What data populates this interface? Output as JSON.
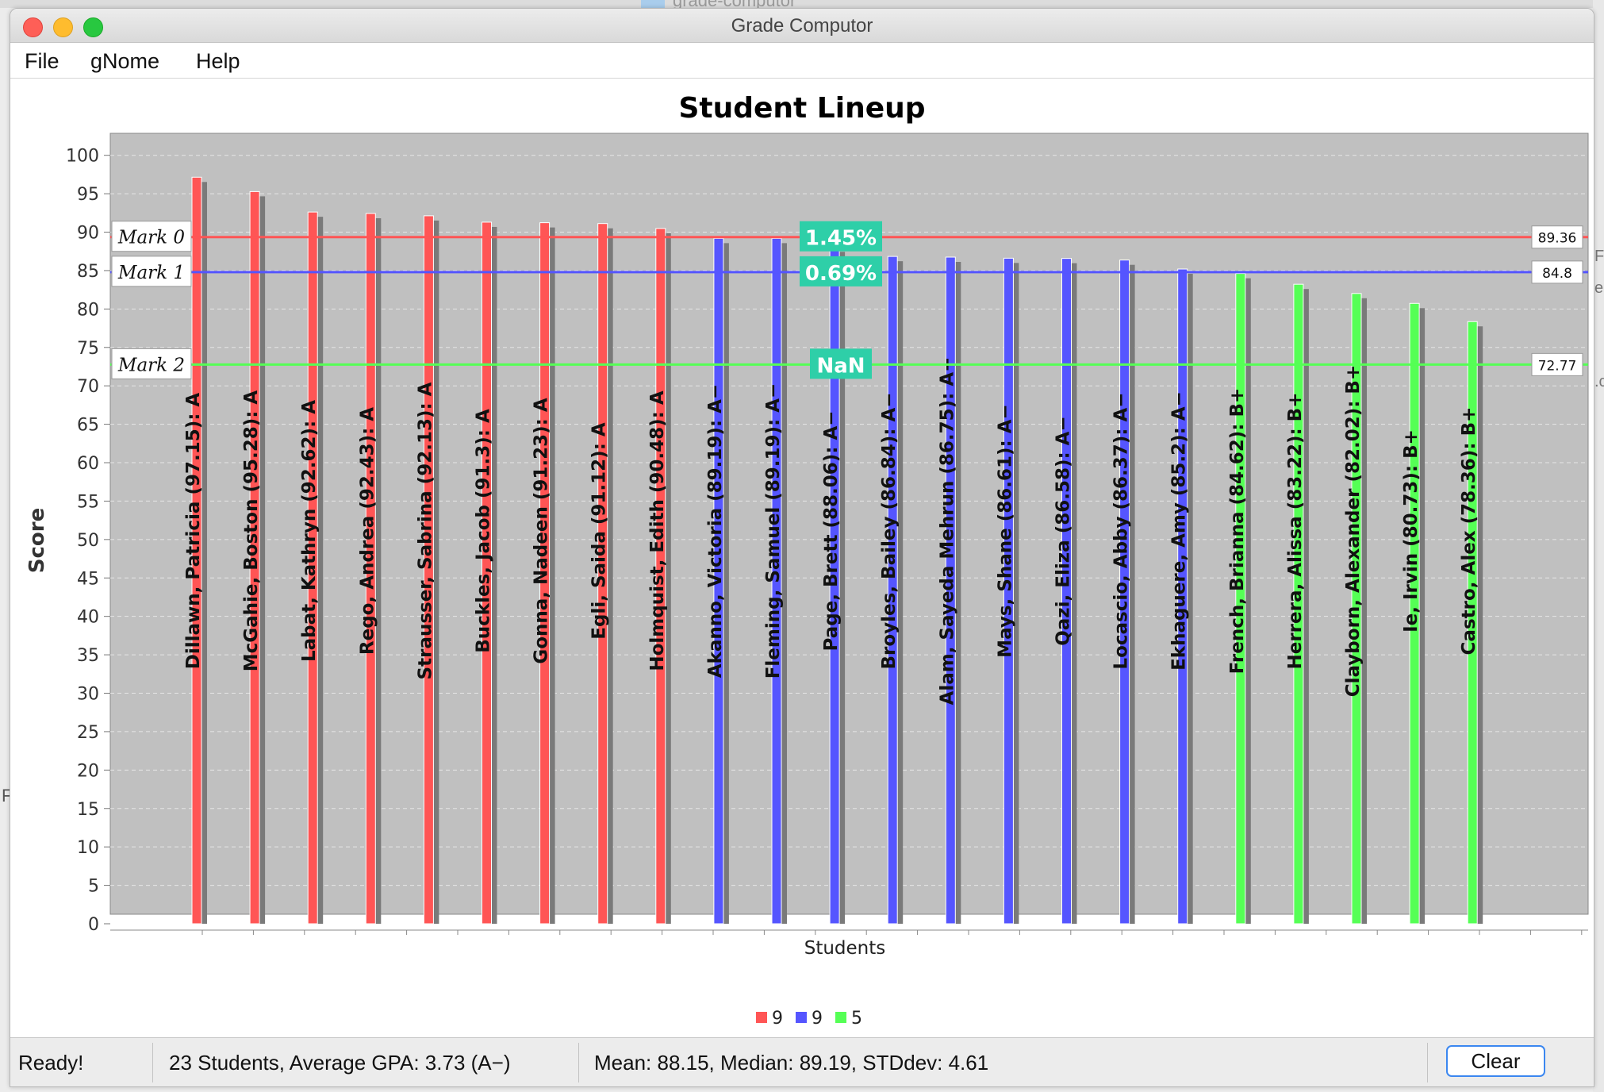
{
  "background": {
    "tab_text": "grade-computor",
    "right_edge_glyphs": [
      "F",
      "e",
      ".c"
    ],
    "left_glyph": "F"
  },
  "window": {
    "title": "Grade Computor"
  },
  "menu": [
    "File",
    "gNome",
    "Help"
  ],
  "chart_data": {
    "type": "bar",
    "title": "Student Lineup",
    "xlabel": "Students",
    "ylabel": "Score",
    "ylim": [
      0,
      100
    ],
    "ytick_step": 5,
    "grid": true,
    "categories": [
      "Dillawn, Patricia (97.15): A",
      "McGahie, Boston (95.28): A",
      "Labat, Kathryn (92.62): A",
      "Rego, Andrea (92.43): A",
      "Strausser, Sabrina (92.13): A",
      "Buckles, Jacob (91.3): A",
      "Gonna, Nadeen (91.23): A",
      "Egli, Saida (91.12): A",
      "Holmquist, Edith (90.48): A",
      "Akanno, Victoria (89.19): A−",
      "Fleming, Samuel (89.19): A−",
      "Page, Brett (88.06): A−",
      "Broyles, Bailey (86.84): A−",
      "Alam, Sayeda Mehrun (86.75): A−",
      "Mays, Shane (86.61): A−",
      "Qazi, Eliza (86.58): A−",
      "Locascio, Abby (86.37): A−",
      "Ekhaguere, Amy (85.2): A−",
      "French, Brianna (84.62): B+",
      "Herrera, Alissa (83.22): B+",
      "Clayborn, Alexander (82.02): B+",
      "Ie, Irvin (80.73): B+",
      "Castro, Alex (78.36): B+"
    ],
    "values": [
      97.15,
      95.28,
      92.62,
      92.43,
      92.13,
      91.3,
      91.23,
      91.12,
      90.48,
      89.19,
      89.19,
      88.06,
      86.84,
      86.75,
      86.61,
      86.58,
      86.37,
      85.2,
      84.62,
      83.22,
      82.02,
      80.73,
      78.36
    ],
    "groups": [
      0,
      0,
      0,
      0,
      0,
      0,
      0,
      0,
      0,
      1,
      1,
      1,
      1,
      1,
      1,
      1,
      1,
      1,
      2,
      2,
      2,
      2,
      2
    ],
    "series": [
      {
        "name": "9",
        "color": "#ff5555"
      },
      {
        "name": "9",
        "color": "#5555ff"
      },
      {
        "name": "5",
        "color": "#55ff55"
      }
    ],
    "markers": [
      {
        "label": "Mark 0",
        "value": 89.36,
        "value_label": "89.36",
        "pct": "1.45%",
        "color": "#ff5555"
      },
      {
        "label": "Mark 1",
        "value": 84.8,
        "value_label": "84.8",
        "pct": "0.69%",
        "color": "#5555ff"
      },
      {
        "label": "Mark 2",
        "value": 72.77,
        "value_label": "72.77",
        "pct": "NaN",
        "color": "#55ff55"
      }
    ],
    "legend_position": "bottom"
  },
  "status": {
    "ready": "Ready!",
    "summary": "23 Students,  Average GPA: 3.73 (A−)",
    "stats": "Mean: 88.15, Median: 89.19, STDdev: 4.61",
    "clear_label": "Clear"
  }
}
